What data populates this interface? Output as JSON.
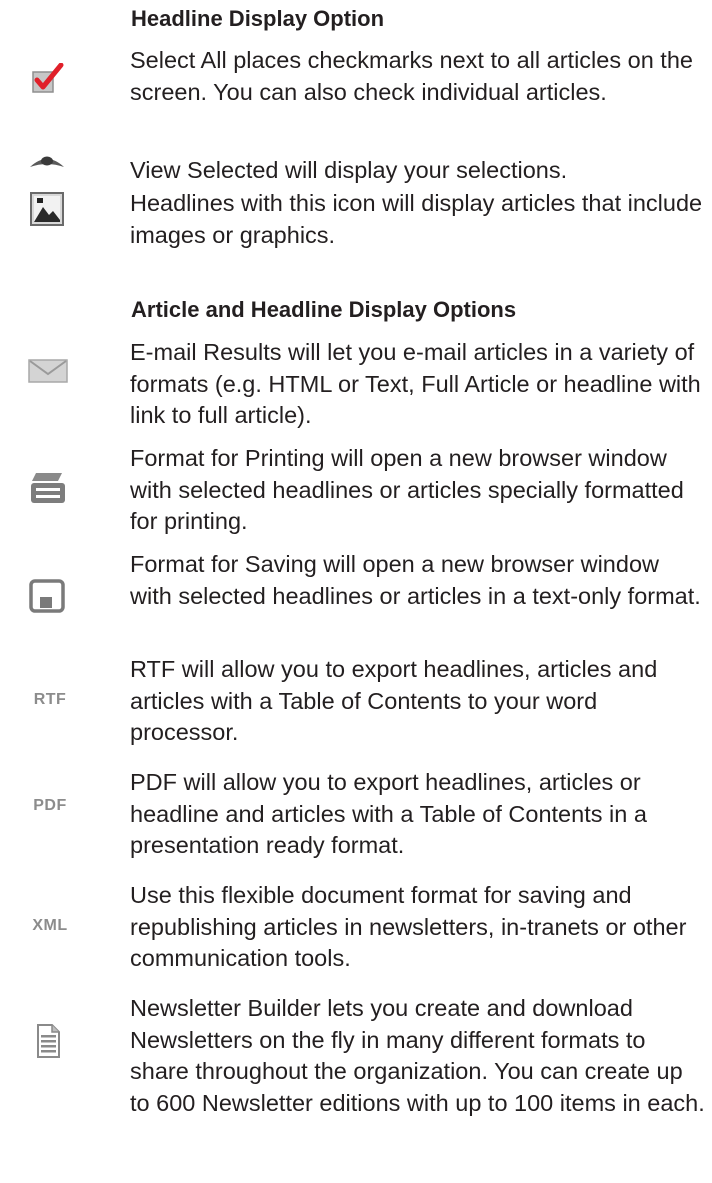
{
  "sections": [
    {
      "heading": "Headline Display Option",
      "items": [
        {
          "icon": "checkbox-checked-icon",
          "text": "Select All places checkmarks next to all articles on the screen.  You can also check individual articles."
        },
        {
          "icon": "eye-icon",
          "text": "View Selected will display your selections."
        },
        {
          "icon": "image-icon",
          "text": "Headlines with this icon will display articles that include images or graphics."
        }
      ]
    },
    {
      "heading": "Article and Headline Display Options",
      "items": [
        {
          "icon": "envelope-icon",
          "text": "E-mail Results will let you e-mail articles in a variety of formats (e.g. HTML or Text, Full Article or headline with link to full article)."
        },
        {
          "icon": "printer-icon",
          "text": "Format for Printing will open a new browser window with selected headlines or articles specially formatted for printing."
        },
        {
          "icon": "save-icon",
          "text": "Format for Saving will open a new browser window with selected headlines or articles in a text-only format."
        },
        {
          "icon": "rtf-icon",
          "icon_label": "RTF",
          "text": "RTF will allow you to export headlines, articles and articles with a Table of Contents to your word processor."
        },
        {
          "icon": "pdf-icon",
          "icon_label": "PDF",
          "text": "PDF will allow you to export headlines, articles or headline and articles with a Table of Contents in a presentation ready format."
        },
        {
          "icon": "xml-icon",
          "icon_label": "XML",
          "text": "Use this flexible document format for saving and republishing articles in newsletters, in-tranets or other communication tools."
        },
        {
          "icon": "newsletter-icon",
          "text": "Newsletter Builder lets you create and download Newsletters on the fly in many different formats to share throughout the organization.  You can create up to 600 Newsletter editions with up to 100 items in each."
        }
      ]
    }
  ],
  "colors": {
    "text": "#231f20",
    "check_red": "#e0202a",
    "icon_gray": "#8c8c8c"
  }
}
